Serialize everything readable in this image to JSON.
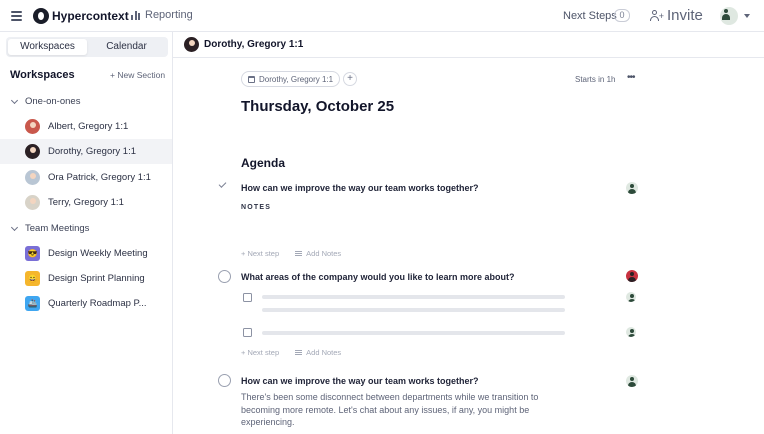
{
  "app": {
    "brand": "Hypercontext",
    "reporting": "Reporting"
  },
  "topbar": {
    "next_steps": "Next Steps",
    "next_steps_count": "0",
    "invite": "Invite"
  },
  "sidebar": {
    "tabs": [
      {
        "label": "Workspaces",
        "active": true
      },
      {
        "label": "Calendar",
        "active": false
      }
    ],
    "title": "Workspaces",
    "new_section": "+ New Section",
    "groups": [
      {
        "label": "One-on-ones",
        "items": [
          {
            "label": "Albert, Gregory 1:1"
          },
          {
            "label": "Dorothy, Gregory 1:1",
            "selected": true
          },
          {
            "label": "Ora Patrick, Gregory 1:1"
          },
          {
            "label": "Terry, Gregory 1:1"
          }
        ]
      },
      {
        "label": "Team Meetings",
        "items": [
          {
            "label": "Design Weekly Meeting",
            "icon": "😎"
          },
          {
            "label": "Design Sprint Planning",
            "icon": "😄"
          },
          {
            "label": "Quarterly Roadmap P...",
            "icon": "🚢"
          }
        ]
      }
    ]
  },
  "main": {
    "title": "Dorothy, Gregory 1:1",
    "chip": "Dorothy, Gregory 1:1",
    "add_chip": "+",
    "starts_in": "Starts in 1h",
    "more": "•••",
    "date": "Thursday, October 25",
    "agenda_title": "Agenda",
    "items": [
      {
        "question": "How can we improve the way our team works together?",
        "status": "done",
        "notes_label": "NOTES",
        "next_step": "+ Next step",
        "add_notes": "Add Notes"
      },
      {
        "question": "What areas of the company would you like to learn more about?",
        "status": "open",
        "next_step": "+ Next step",
        "add_notes": "Add Notes"
      },
      {
        "question": "How can we improve the way our team works together?",
        "status": "open",
        "description": "There's been some disconnect between departments while we transition to becoming more remote. Let's chat about any issues, if any, you might be experiencing."
      }
    ]
  }
}
